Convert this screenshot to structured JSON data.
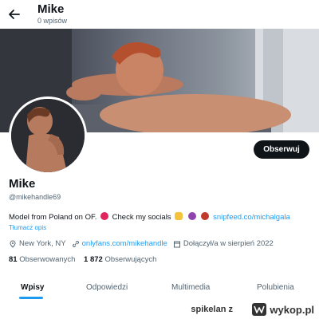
{
  "header": {
    "title": "Mike",
    "subtitle": "0 wpisów"
  },
  "profile": {
    "follow_label": "Obserwuj",
    "name": "Mike",
    "handle": "@mikehandle69",
    "bio_text": "Model from Poland on OF.",
    "bio_text2": "Check my socials",
    "bio_link": "snipfeed.co/michalgala",
    "translate_label": "Tłumacz opis",
    "location": "New York, NY",
    "website": "onlyfans.com/mikehandle",
    "joined": "Dołączył/a w sierpień 2022",
    "following_count": "81",
    "following_label": "Obserwowanych",
    "followers_count": "1 872",
    "followers_label": "Obserwujących"
  },
  "tabs": [
    {
      "label": "Wpisy",
      "active": true
    },
    {
      "label": "Odpowiedzi",
      "active": false
    },
    {
      "label": "Multimedia",
      "active": false
    },
    {
      "label": "Polubienia",
      "active": false
    }
  ],
  "watermark": {
    "user": "spikelan",
    "separator": "z",
    "site": "wykop.pl"
  },
  "icons": [
    "back-arrow-icon",
    "location-icon",
    "link-icon",
    "calendar-icon",
    "wykop-logo-icon"
  ],
  "colors": {
    "accent": "#1d9bf0",
    "text": "#0f1419",
    "muted": "#536471",
    "button": "#0f1419"
  }
}
